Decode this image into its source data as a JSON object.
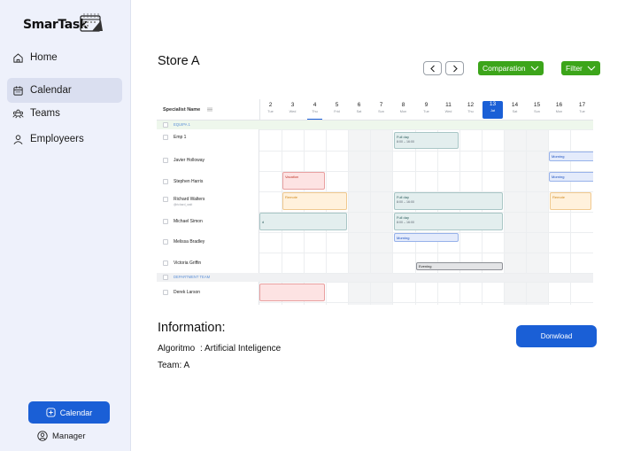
{
  "app": {
    "logo_text": "SmarTask"
  },
  "sidebar": {
    "items": [
      {
        "label": "Home",
        "icon": "home-icon"
      },
      {
        "label": "Calendar",
        "icon": "calendar-icon",
        "active": true
      },
      {
        "label": "Teams",
        "icon": "teams-icon"
      },
      {
        "label": "Employeers",
        "icon": "user-icon"
      }
    ],
    "calendar_button": "Calendar",
    "manager_label": "Manager"
  },
  "header": {
    "title": "Store A",
    "comparation_label": "Comparation",
    "filter_label": "Filter"
  },
  "calendar": {
    "name_header": "Specialist Name",
    "days": [
      {
        "num": "2",
        "dn": "Tue"
      },
      {
        "num": "3",
        "dn": "Wed"
      },
      {
        "num": "4",
        "dn": "Thu"
      },
      {
        "num": "5",
        "dn": "Frid"
      },
      {
        "num": "6",
        "dn": "Sat"
      },
      {
        "num": "7",
        "dn": "Sun"
      },
      {
        "num": "8",
        "dn": "Mon"
      },
      {
        "num": "9",
        "dn": "Tue"
      },
      {
        "num": "11",
        "dn": "Wed"
      },
      {
        "num": "12",
        "dn": "Thu"
      },
      {
        "num": "13",
        "dn": "Jat"
      },
      {
        "num": "14",
        "dn": "Sat"
      },
      {
        "num": "15",
        "dn": "Sun"
      },
      {
        "num": "16",
        "dn": "Mon"
      },
      {
        "num": "17",
        "dn": "Tue"
      }
    ],
    "groups": {
      "equipa": "EQUIPA 1",
      "department": "DEPARTMENT TEAM"
    },
    "people": [
      {
        "name": "Emp 1",
        "sub": ""
      },
      {
        "name": "Javier Holloway",
        "sub": ""
      },
      {
        "name": "Stephen Harris",
        "sub": ""
      },
      {
        "name": "Richard Walters",
        "sub": "@richard_walt"
      },
      {
        "name": "Michael Simon",
        "sub": ""
      },
      {
        "name": "Melissa Bradley",
        "sub": ""
      },
      {
        "name": "Victoria Griffin",
        "sub": ""
      },
      {
        "name": "Derek Larson",
        "sub": ""
      }
    ],
    "events": {
      "fullday_label": "Full day",
      "fullday_time": "8:00 – 16:00",
      "morning": "Morning",
      "vacation": "Vacation",
      "remote": "Remote",
      "evening": "Evening",
      "partial_edge": "d"
    }
  },
  "info": {
    "title": "Information:",
    "algorithm_label": "Algoritmo",
    "algorithm_value": "Artificial Inteligence",
    "team_label": "Team:",
    "team_value": "A",
    "download_label": "Donwload"
  }
}
